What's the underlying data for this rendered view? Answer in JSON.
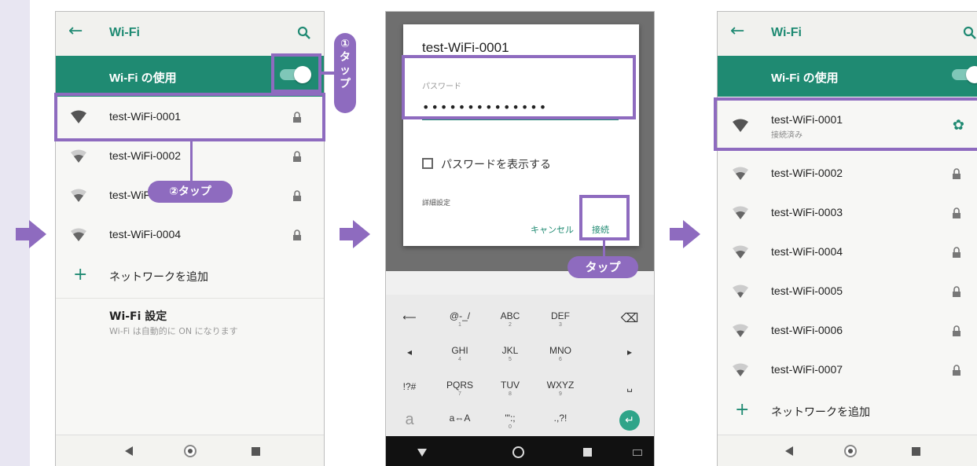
{
  "colors": {
    "accent": "#8e6bbf",
    "brand_green": "#1f8a72",
    "sidebar": "#e8e6f2"
  },
  "screen1": {
    "title": "Wi-Fi",
    "back_icon": "arrow-left-icon",
    "search_icon": "search-icon",
    "toggle_label": "Wi-Fi の使用",
    "toggle_on": true,
    "networks": [
      {
        "name": "test-WiFi-0001"
      },
      {
        "name": "test-WiFi-0002"
      },
      {
        "name": "test-WiFi-0003"
      },
      {
        "name": "test-WiFi-0004"
      }
    ],
    "add_network": "ネットワークを追加",
    "settings_title": "Wi-Fi 設定",
    "settings_sub": "Wi-Fi は自動的に ON になります",
    "callout1": "① タップ",
    "callout1_chars": [
      "①",
      "タ",
      "ッ",
      "プ"
    ],
    "callout2": "②タップ"
  },
  "screen2": {
    "dialog_title": "test-WiFi-0001",
    "password_label": "パスワード",
    "password_value": "••••••••••••••",
    "show_password": "パスワードを表示する",
    "advanced": "詳細設定",
    "cancel": "キャンセル",
    "connect": "接続",
    "callout": "タップ",
    "keys": {
      "r1": [
        {
          "m": "@-_/",
          "s": "1"
        },
        {
          "m": "ABC",
          "s": "2"
        },
        {
          "m": "DEF",
          "s": "3"
        }
      ],
      "r2": [
        {
          "m": "GHI",
          "s": "4"
        },
        {
          "m": "JKL",
          "s": "5"
        },
        {
          "m": "MNO",
          "s": "6"
        }
      ],
      "r3": [
        {
          "m": "PQRS",
          "s": "7"
        },
        {
          "m": "TUV",
          "s": "8"
        },
        {
          "m": "WXYZ",
          "s": "9"
        }
      ],
      "r4": [
        {
          "m": "a⇔A",
          "s": ""
        },
        {
          "m": "'\":;",
          "s": "0"
        },
        {
          "m": ".,?!",
          "s": ""
        }
      ],
      "left": [
        "⟵",
        "◂",
        "!?#",
        "a"
      ],
      "right": [
        "⌫",
        "▸",
        "␣",
        "↵"
      ]
    }
  },
  "screen3": {
    "title": "Wi-Fi",
    "toggle_label": "Wi-Fi の使用",
    "connected": {
      "name": "test-WiFi-0001",
      "status": "接続済み"
    },
    "networks": [
      {
        "name": "test-WiFi-0002"
      },
      {
        "name": "test-WiFi-0003"
      },
      {
        "name": "test-WiFi-0004"
      },
      {
        "name": "test-WiFi-0005"
      },
      {
        "name": "test-WiFi-0006"
      },
      {
        "name": "test-WiFi-0007"
      }
    ],
    "add_network": "ネットワークを追加"
  }
}
